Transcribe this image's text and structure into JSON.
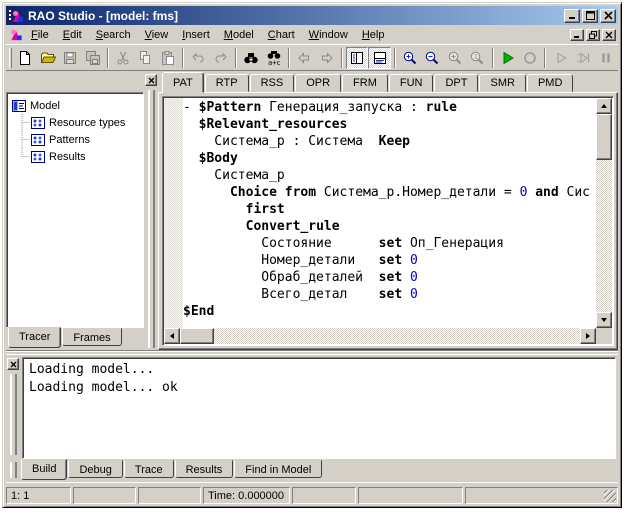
{
  "window": {
    "title": "RAO Studio - [model: fms]"
  },
  "title_buttons": [
    "minimize",
    "maximize",
    "close"
  ],
  "mdi_buttons": [
    "minimize",
    "restore",
    "close"
  ],
  "menu": {
    "items": [
      "File",
      "Edit",
      "Search",
      "View",
      "Insert",
      "Model",
      "Chart",
      "Window",
      "Help"
    ]
  },
  "toolbar": {
    "buttons": [
      {
        "name": "new",
        "enabled": true
      },
      {
        "name": "open",
        "enabled": true
      },
      {
        "name": "save",
        "enabled": false
      },
      {
        "name": "save-all",
        "enabled": false
      },
      {
        "name": "cut",
        "enabled": false
      },
      {
        "name": "copy",
        "enabled": false
      },
      {
        "name": "paste",
        "enabled": false
      },
      {
        "name": "undo",
        "enabled": false
      },
      {
        "name": "redo",
        "enabled": false
      },
      {
        "name": "find",
        "enabled": true
      },
      {
        "name": "replace",
        "enabled": true
      },
      {
        "name": "navigate-back",
        "enabled": false
      },
      {
        "name": "navigate-forward",
        "enabled": false
      },
      {
        "name": "toggle-workspace-panel",
        "enabled": true,
        "pressed": true
      },
      {
        "name": "toggle-output-panel",
        "enabled": true,
        "pressed": true
      },
      {
        "name": "zoom-in",
        "enabled": true
      },
      {
        "name": "zoom-out",
        "enabled": true
      },
      {
        "name": "zoom-auto",
        "enabled": false
      },
      {
        "name": "zoom-one-to-one",
        "enabled": false
      },
      {
        "name": "run-model",
        "enabled": true
      },
      {
        "name": "stop",
        "enabled": false
      },
      {
        "name": "play",
        "enabled": false
      },
      {
        "name": "step",
        "enabled": false
      },
      {
        "name": "pause",
        "enabled": false
      }
    ]
  },
  "doc_tabs": {
    "items": [
      "PAT",
      "RTP",
      "RSS",
      "OPR",
      "FRM",
      "FUN",
      "DPT",
      "SMR",
      "PMD"
    ],
    "active_index": 0
  },
  "workspace_tree": {
    "root": "Model",
    "children": [
      "Resource types",
      "Patterns",
      "Results"
    ]
  },
  "left_tabs": {
    "items": [
      "Tracer",
      "Frames"
    ],
    "active_index": 0
  },
  "editor": {
    "lines": [
      [
        {
          "s": "p",
          "t": "- "
        },
        {
          "s": "k",
          "t": "$Pattern"
        },
        {
          "s": "p",
          "t": " Генерация_запуска : "
        },
        {
          "s": "k",
          "t": "rule"
        }
      ],
      [
        {
          "s": "p",
          "t": "  "
        },
        {
          "s": "k",
          "t": "$Relevant_resources"
        }
      ],
      [
        {
          "s": "p",
          "t": "    Система_р : Система  "
        },
        {
          "s": "k",
          "t": "Keep"
        }
      ],
      [
        {
          "s": "p",
          "t": "  "
        },
        {
          "s": "k",
          "t": "$Body"
        }
      ],
      [
        {
          "s": "p",
          "t": "    Система_р"
        }
      ],
      [
        {
          "s": "p",
          "t": "      "
        },
        {
          "s": "k",
          "t": "Choice from"
        },
        {
          "s": "p",
          "t": " Система_р.Номер_детали = "
        },
        {
          "s": "n",
          "t": "0"
        },
        {
          "s": "p",
          "t": " "
        },
        {
          "s": "k",
          "t": "and"
        },
        {
          "s": "p",
          "t": " Сис"
        }
      ],
      [
        {
          "s": "p",
          "t": "        "
        },
        {
          "s": "k",
          "t": "first"
        }
      ],
      [
        {
          "s": "p",
          "t": "        "
        },
        {
          "s": "k",
          "t": "Convert_rule"
        }
      ],
      [
        {
          "s": "p",
          "t": "          Состояние      "
        },
        {
          "s": "k",
          "t": "set"
        },
        {
          "s": "p",
          "t": " Оп_Генерация"
        }
      ],
      [
        {
          "s": "p",
          "t": "          Номер_детали   "
        },
        {
          "s": "k",
          "t": "set"
        },
        {
          "s": "p",
          "t": " "
        },
        {
          "s": "n",
          "t": "0"
        }
      ],
      [
        {
          "s": "p",
          "t": "          Обраб_деталей  "
        },
        {
          "s": "k",
          "t": "set"
        },
        {
          "s": "p",
          "t": " "
        },
        {
          "s": "n",
          "t": "0"
        }
      ],
      [
        {
          "s": "p",
          "t": "          Всего_детал    "
        },
        {
          "s": "k",
          "t": "set"
        },
        {
          "s": "p",
          "t": " "
        },
        {
          "s": "n",
          "t": "0"
        }
      ],
      [
        {
          "s": "k",
          "t": "$End"
        }
      ]
    ]
  },
  "output": {
    "lines": [
      "Loading model...",
      "Loading model... ok"
    ]
  },
  "bottom_tabs": {
    "items": [
      "Build",
      "Debug",
      "Trace",
      "Results",
      "Find in Model"
    ],
    "active_index": 0
  },
  "status_bar": {
    "panels": [
      "1: 1",
      "",
      "",
      "Time: 0.000000",
      "",
      "",
      ""
    ]
  },
  "colors": {
    "face": "#d4d0c8",
    "title_gradient_start": "#0a246a",
    "title_gradient_end": "#a6caf0",
    "keyword": "#000000",
    "number": "#0000c8"
  }
}
